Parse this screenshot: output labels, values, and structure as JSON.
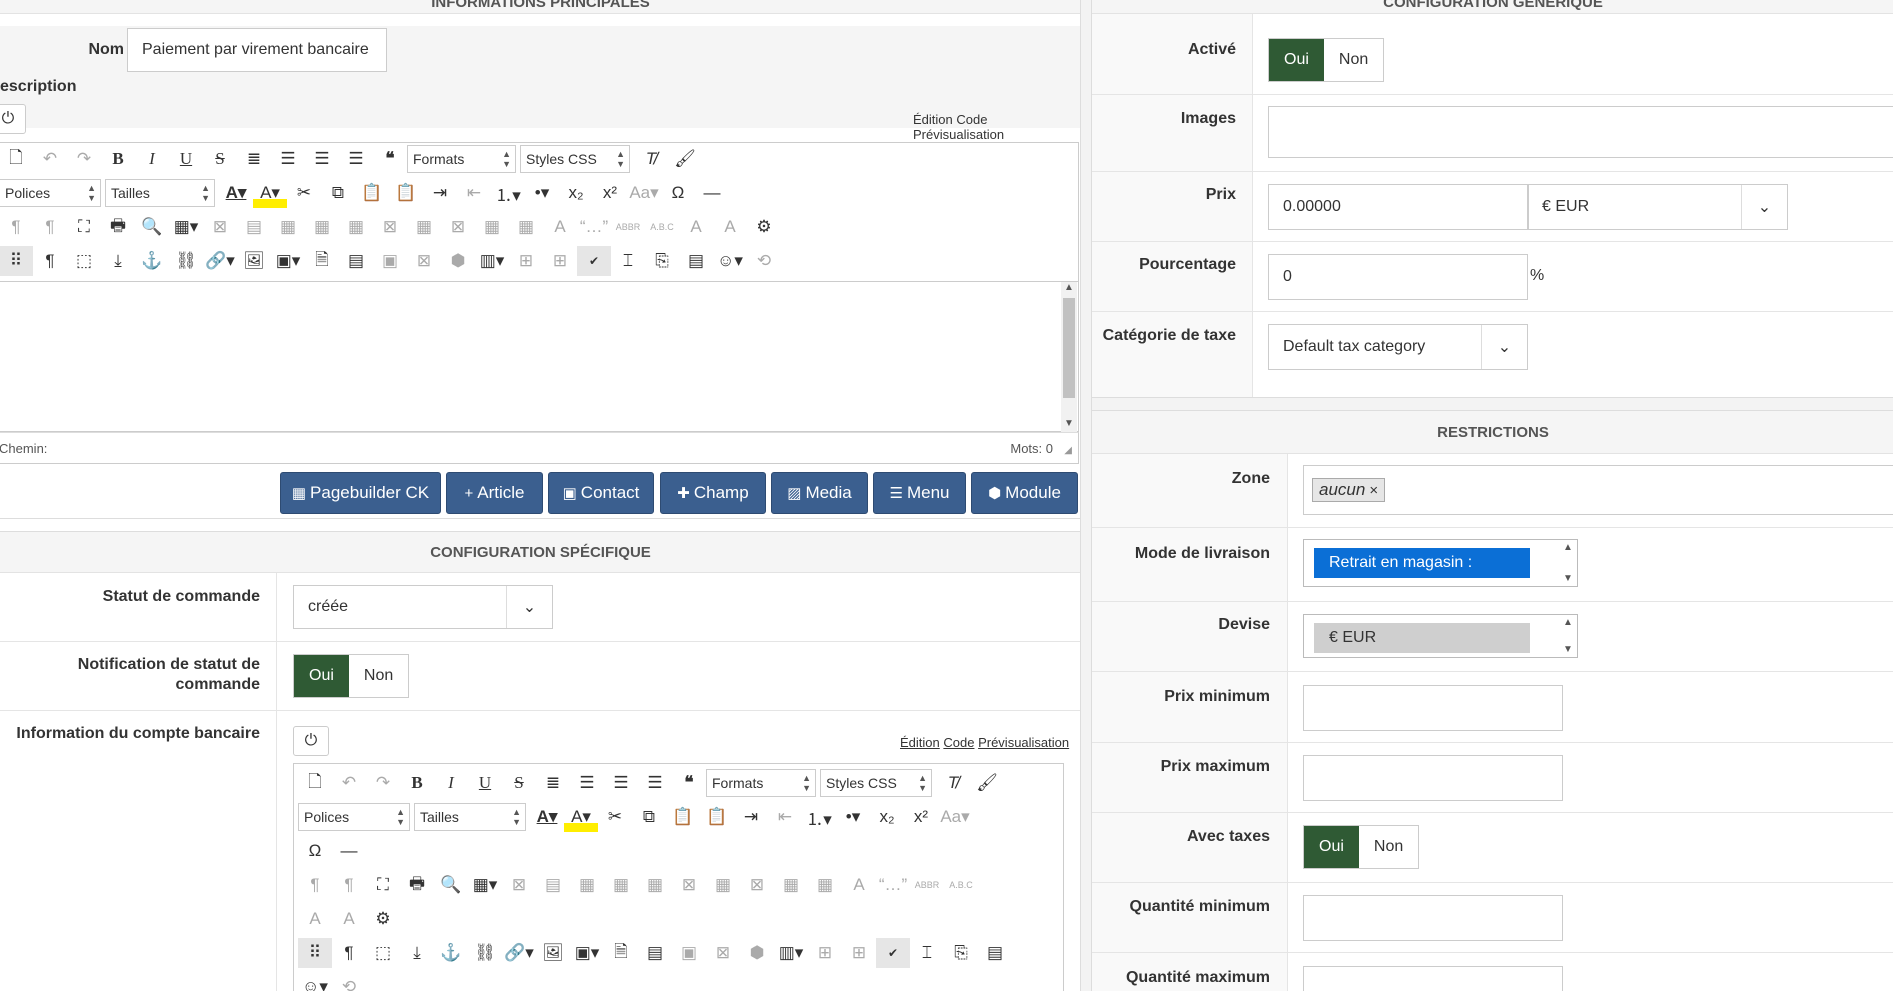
{
  "left": {
    "main_info_title": "INFORMATIONS PRINCIPALES",
    "name_label": "Nom",
    "name_value": "Paiement par virement bancaire",
    "description_label": "escription",
    "editor_modes": "Édition Code Prévisualisation",
    "editor_status_path": "Chemin:",
    "editor_word_count": "Mots: 0",
    "toolbar": {
      "formats": "Formats",
      "styles": "Styles CSS",
      "fonts": "Polices",
      "sizes": "Tailles"
    },
    "action_buttons": [
      {
        "label": "Pagebuilder CK",
        "icon": "grid-icon"
      },
      {
        "label": "Article",
        "icon": "plus-icon"
      },
      {
        "label": "Contact",
        "icon": "contact-icon"
      },
      {
        "label": "Champ",
        "icon": "puzzle-icon"
      },
      {
        "label": "Media",
        "icon": "image-icon"
      },
      {
        "label": "Menu",
        "icon": "list-icon"
      },
      {
        "label": "Module",
        "icon": "cube-icon"
      }
    ],
    "specific_config_title": "CONFIGURATION SPÉCIFIQUE",
    "order_status_label": "Statut de commande",
    "order_status_value": "créée",
    "notification_label": "Notification de statut de commande",
    "yes": "Oui",
    "no": "Non",
    "bank_info_label": "Information du compte bancaire",
    "edit_mode": "Édition",
    "code_mode": "Code",
    "preview_mode": "Prévisualisation"
  },
  "right": {
    "generic_config_title": "CONFIGURATION GÉNÉRIQUE",
    "active_label": "Activé",
    "images_label": "Images",
    "price_label": "Prix",
    "price_value": "0.00000",
    "currency_value": "€ EUR",
    "percent_label": "Pourcentage",
    "percent_value": "0",
    "percent_unit": "%",
    "tax_cat_label": "Catégorie de taxe",
    "tax_cat_value": "Default tax category",
    "restrictions_title": "RESTRICTIONS",
    "zone_label": "Zone",
    "zone_tag": "aucun",
    "zone_tag_remove": "×",
    "delivery_label": "Mode de livraison",
    "delivery_option": "Retrait en magasin :",
    "currency_label": "Devise",
    "currency_option": "€ EUR",
    "min_price_label": "Prix minimum",
    "max_price_label": "Prix maximum",
    "with_tax_label": "Avec taxes",
    "min_qty_label": "Quantité minimum",
    "max_qty_label": "Quantité maximum",
    "yes": "Oui",
    "no": "Non"
  },
  "colors": {
    "toggle_on": "#2f5a34",
    "action_button": "#3b5f8f",
    "selected_option": "#0b6fd6"
  }
}
